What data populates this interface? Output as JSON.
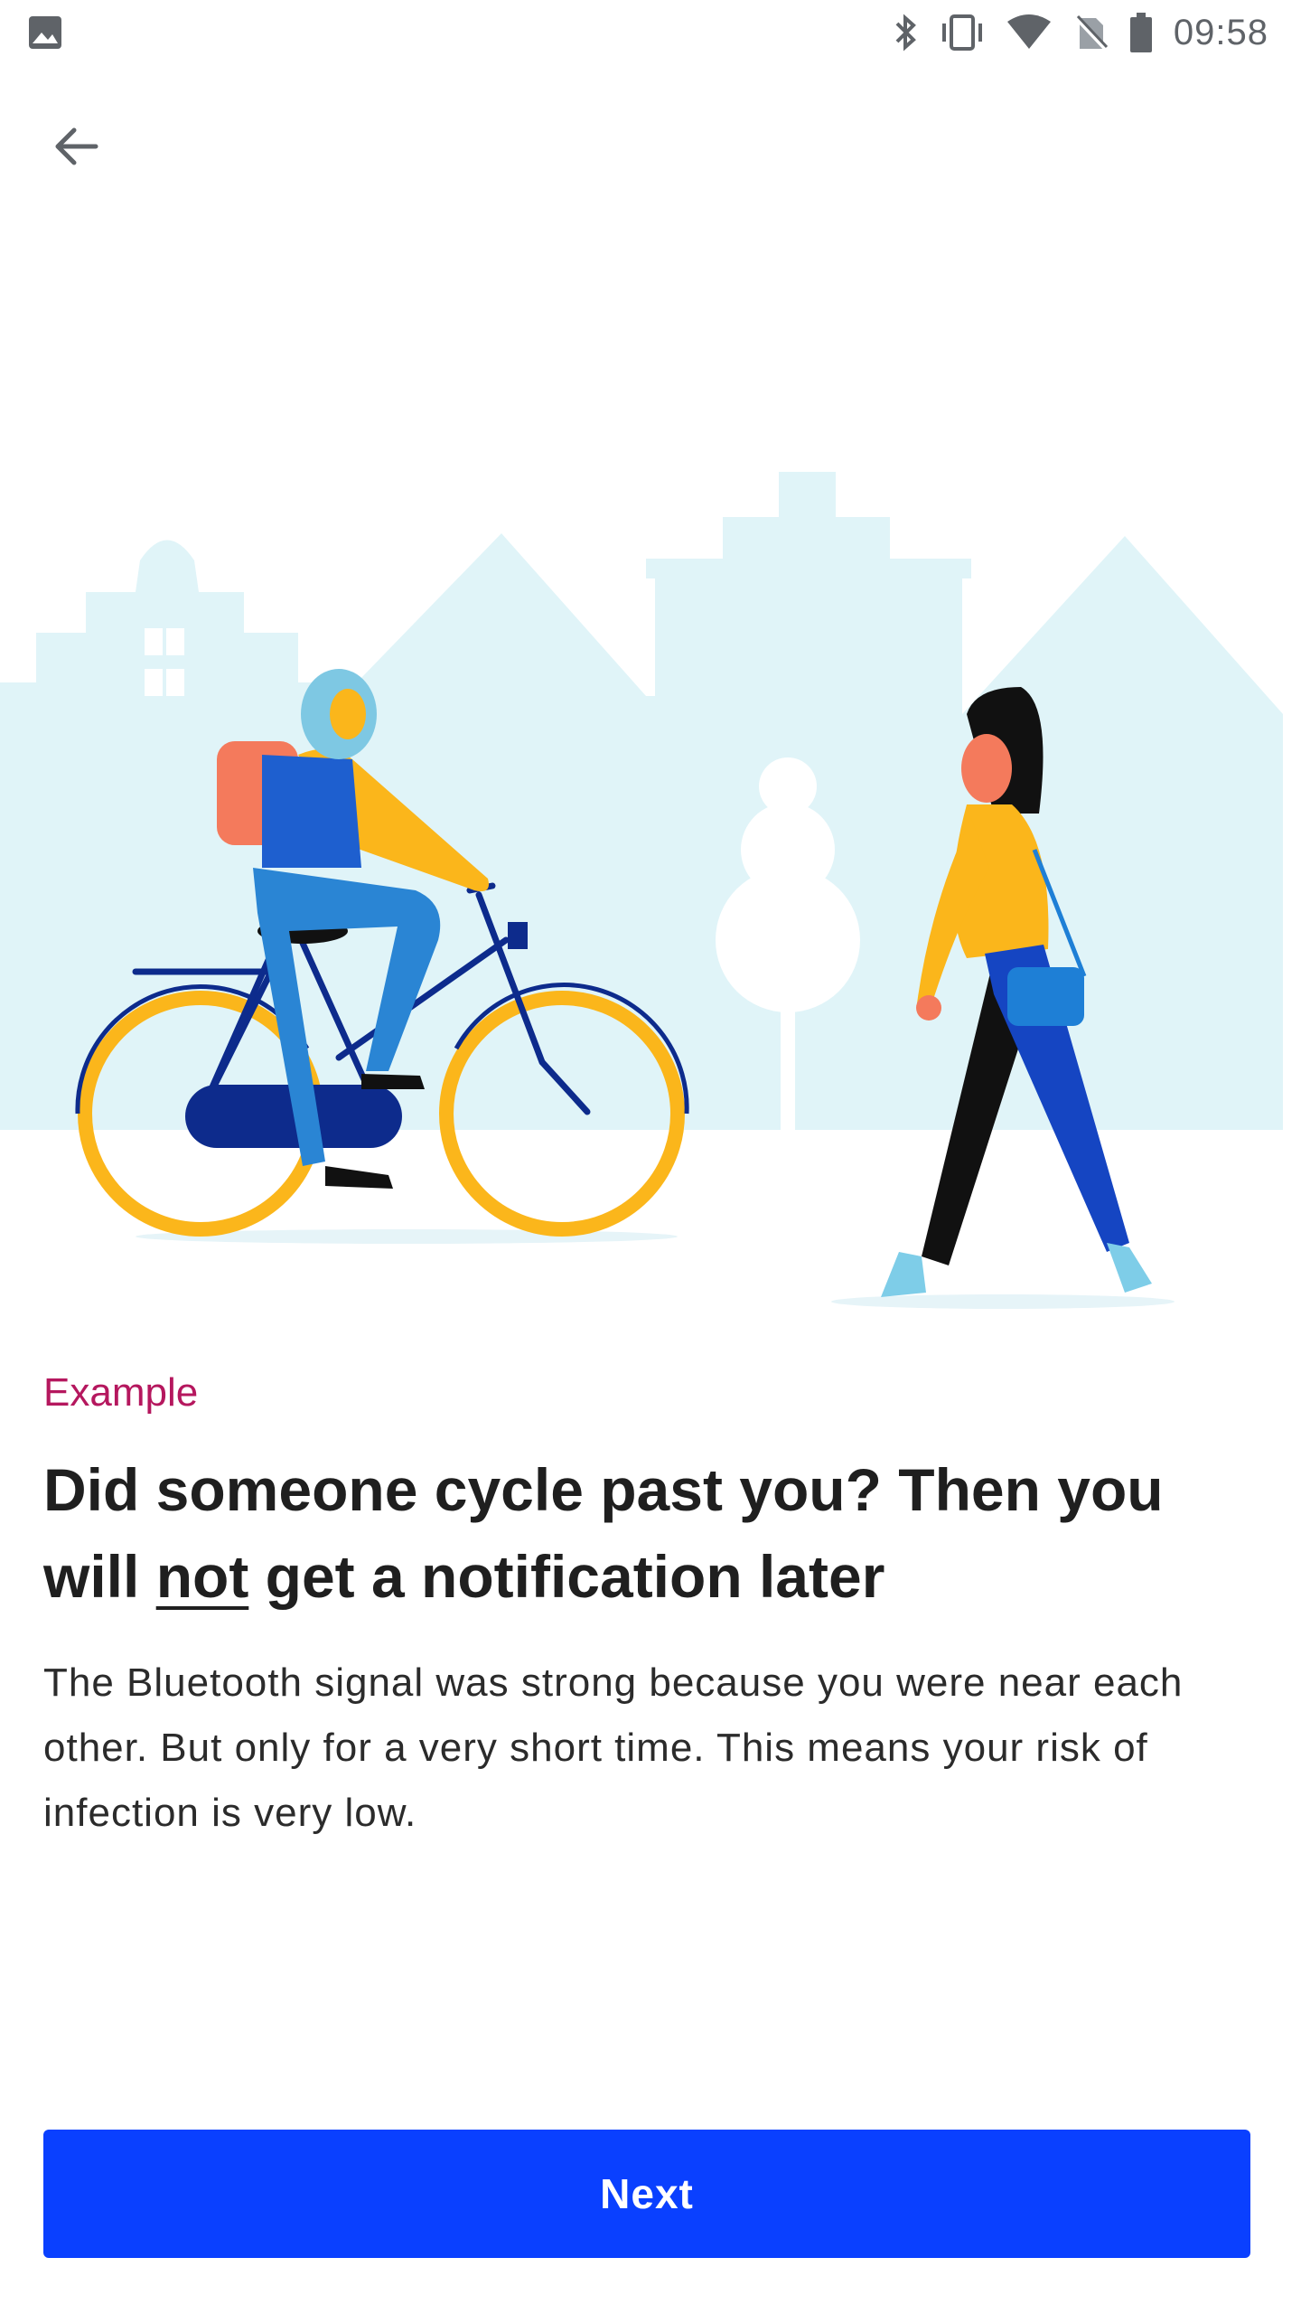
{
  "status_bar": {
    "time": "09:58",
    "icons": [
      "image-icon",
      "bluetooth-icon",
      "vibrate-icon",
      "wifi-icon",
      "no-sim-icon",
      "battery-icon"
    ]
  },
  "nav": {
    "back_icon": "arrow-left-icon"
  },
  "content": {
    "eyebrow": "Example",
    "title_part1": "Did someone cycle past you? Then you will ",
    "title_emphasis": "not",
    "title_part2": " get a notification later",
    "body": "The Bluetooth signal was strong because you were near each other. But only for a very short time. This means your risk of infection is very low."
  },
  "footer": {
    "next_label": "Next"
  },
  "colors": {
    "primary": "#0a40ff",
    "accent": "#b5175e",
    "sky": "#e0f4f8"
  }
}
